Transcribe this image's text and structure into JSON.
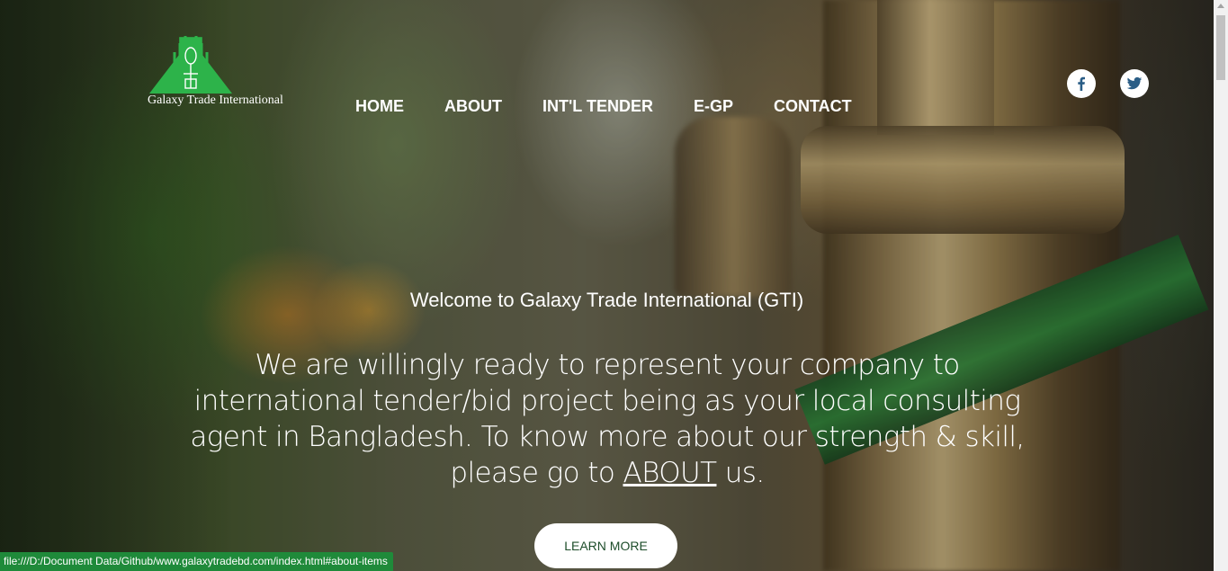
{
  "brand": {
    "name": "Galaxy Trade International",
    "logo_color": "#2db34a"
  },
  "nav": {
    "items": [
      {
        "label": "HOME"
      },
      {
        "label": "ABOUT"
      },
      {
        "label": "INT'L TENDER"
      },
      {
        "label": "E-GP"
      },
      {
        "label": "CONTACT"
      }
    ]
  },
  "social": {
    "facebook_icon": "facebook-icon",
    "twitter_icon": "twitter-icon",
    "icon_color": "#2a5d86"
  },
  "hero": {
    "welcome": "Welcome to Galaxy Trade International (GTI)",
    "tagline_before": "We are willingly ready to represent your company to international tender/bid project being as your local consulting agent in Bangladesh. To know more about our strength & skill, please go to ",
    "tagline_link": "ABOUT",
    "tagline_after": " us.",
    "cta_label": "LEARN MORE",
    "cta_text_color": "#1d4d2a"
  },
  "status_bar": {
    "text": "file:///D:/Document Data/Github/www.galaxytradebd.com/index.html#about-items",
    "color": "#1f8a3a"
  }
}
